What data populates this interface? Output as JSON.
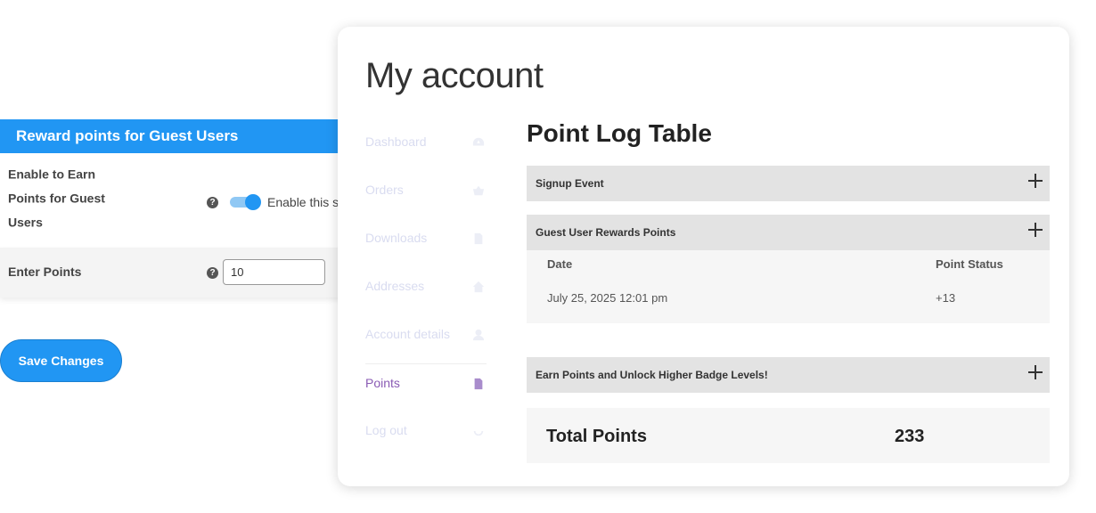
{
  "settings": {
    "header": "Reward points for Guest Users",
    "earn_label": "Enable to Earn Points for Guest Users",
    "toggle_label": "Enable this s",
    "toggle_on": true,
    "points_label": "Enter Points",
    "points_value": "10",
    "help_glyph": "?",
    "save_label": "Save Changes"
  },
  "account": {
    "title": "My account",
    "nav": [
      {
        "label": "Dashboard",
        "icon": "dashboard-icon"
      },
      {
        "label": "Orders",
        "icon": "basket-icon"
      },
      {
        "label": "Downloads",
        "icon": "file-download-icon"
      },
      {
        "label": "Addresses",
        "icon": "home-icon"
      },
      {
        "label": "Account details",
        "icon": "user-icon"
      },
      {
        "label": "Points",
        "icon": "document-icon",
        "active": true
      },
      {
        "label": "Log out",
        "icon": "logout-icon"
      }
    ],
    "section_title": "Point Log Table",
    "accordions": {
      "signup": "Signup Event",
      "guest": "Guest User Rewards Points",
      "badge": "Earn Points and Unlock Higher Badge Levels!"
    },
    "log": {
      "headers": [
        "Date",
        "Point Status"
      ],
      "rows": [
        {
          "date": "July 25, 2025 12:01 pm",
          "status": "+13"
        }
      ]
    },
    "total": {
      "label": "Total Points",
      "value": "233"
    }
  },
  "colors": {
    "accent": "#2196f3",
    "active_nav": "#8a5bb4",
    "accordion_bg": "#e3e3e3"
  }
}
